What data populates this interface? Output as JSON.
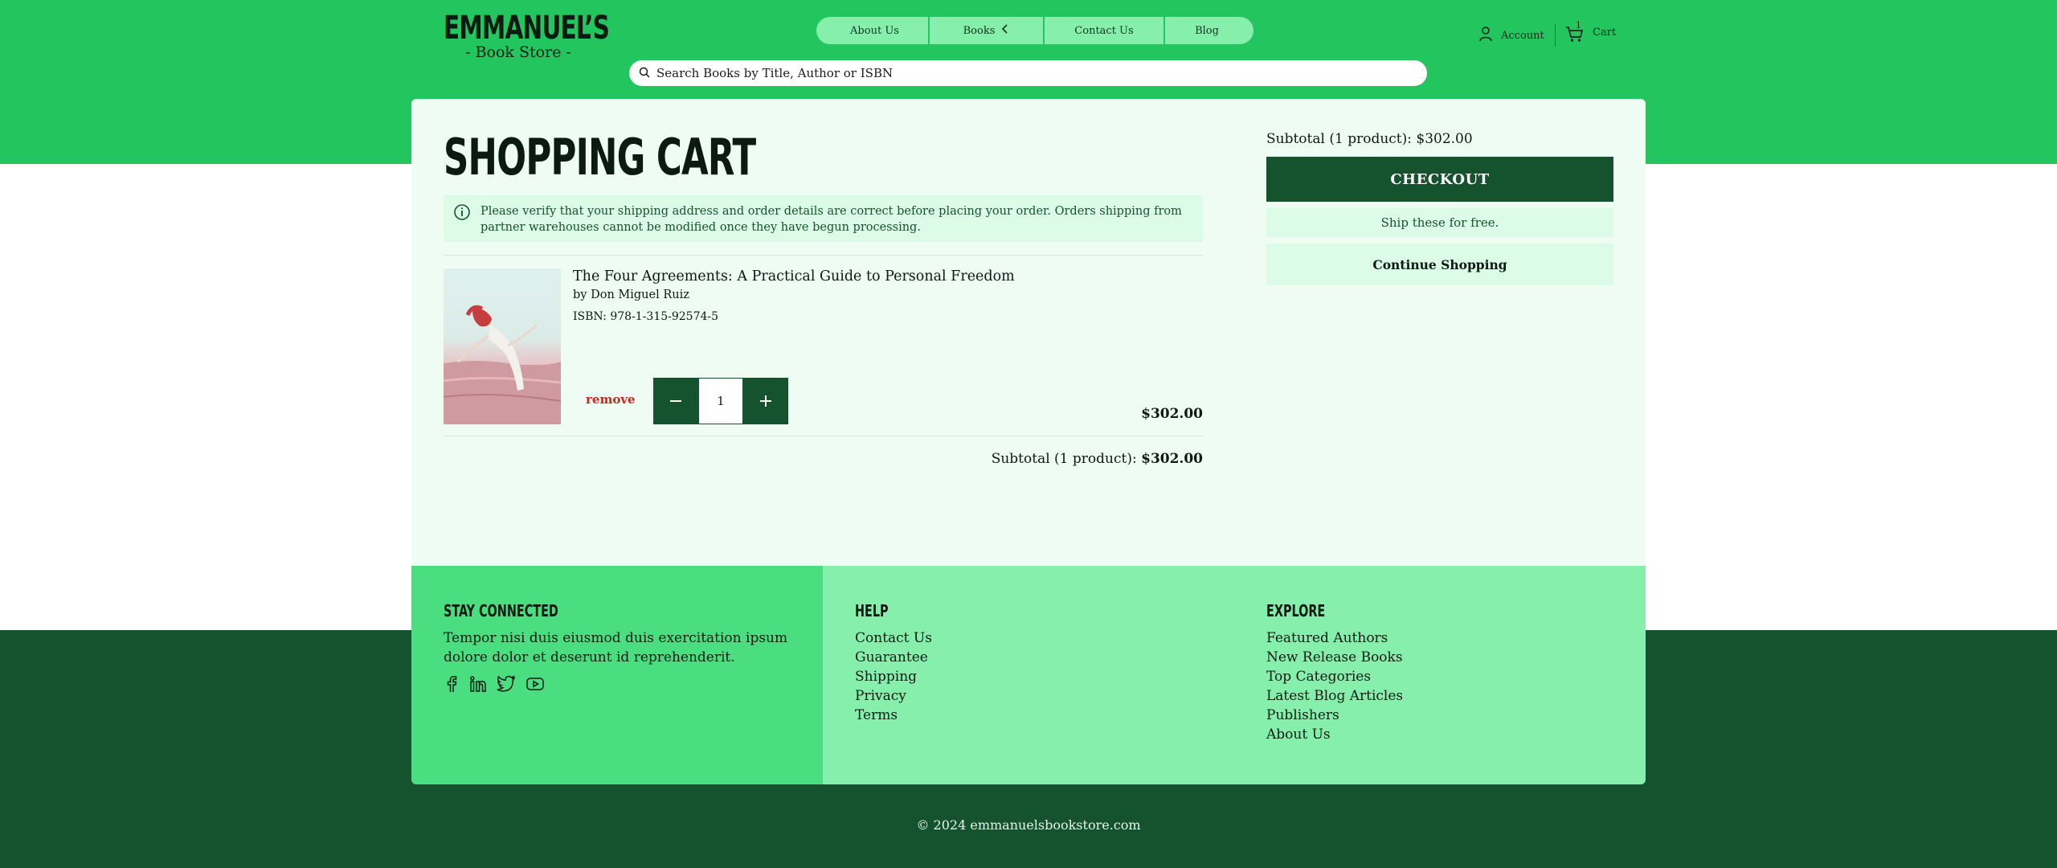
{
  "brand": {
    "title": "EMMANUEL’S",
    "subtitle": "- Book Store -"
  },
  "nav": {
    "items": [
      {
        "label": "About Us"
      },
      {
        "label": "Books"
      },
      {
        "label": "Contact Us"
      },
      {
        "label": "Blog"
      }
    ]
  },
  "search": {
    "placeholder": "Search Books by Title, Author or ISBN"
  },
  "header_actions": {
    "account_label": "Account",
    "cart_label": "Cart",
    "cart_count": "1"
  },
  "cart": {
    "title": "SHOPPING CART",
    "notice": "Please verify that your shipping address and order details are correct before placing your order. Orders shipping from partner warehouses cannot be modified once they have begun processing.",
    "items": [
      {
        "title": "The Four Agreements: A Practical Guide to Personal Freedom",
        "author": "by Don Miguel Ruiz",
        "isbn": "ISBN: 978-1-315-92574-5",
        "remove_label": "remove",
        "quantity": "1",
        "price": "$302.00"
      }
    ],
    "subtotal_label": "Subtotal (1 product): ",
    "subtotal_value": "$302.00"
  },
  "summary": {
    "subtotal": "Subtotal (1 product): $302.00",
    "checkout_label": "CHECKOUT",
    "ship_note": "Ship these for free.",
    "continue_label": "Continue Shopping"
  },
  "footer": {
    "connect": {
      "heading": "STAY CONNECTED",
      "text": "Tempor nisi duis eiusmod duis exercitation ipsum dolore dolor et deserunt id reprehenderit."
    },
    "help": {
      "heading": "HELP",
      "links": [
        "Contact Us",
        "Guarantee",
        "Shipping",
        "Privacy",
        "Terms"
      ]
    },
    "explore": {
      "heading": "EXPLORE",
      "links": [
        "Featured Authors",
        "New Release Books",
        "Top Categories",
        "Latest Blog Articles",
        "Publishers",
        "About Us"
      ]
    },
    "copyright": "© 2024 emmanuelsbookstore.com"
  },
  "colors": {
    "brand_green": "#22c55e",
    "dark_green": "#15532e",
    "light_green": "#86efac",
    "pale_green": "#dcfce7",
    "remove_red": "#c22a1f"
  }
}
